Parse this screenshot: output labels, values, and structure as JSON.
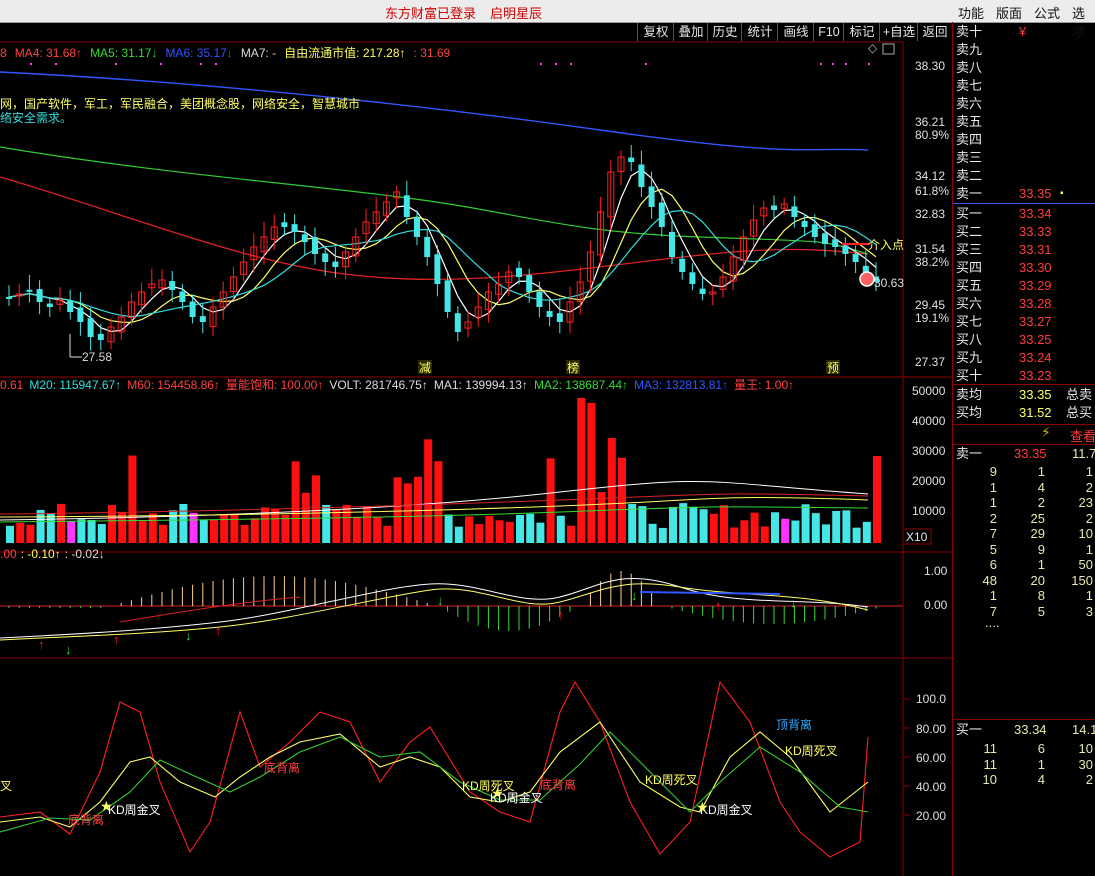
{
  "topbar": {
    "login_status": "东方财富已登录",
    "brand": "启明星辰",
    "menus": [
      "功能",
      "版面",
      "公式",
      "选项"
    ]
  },
  "toolbar": [
    "复权",
    "叠加",
    "历史",
    "统计",
    "画线",
    "F10",
    "标记",
    "+自选",
    "返回"
  ],
  "ma_bar": {
    "items": [
      {
        "text": "8",
        "color": "#ff4040"
      },
      {
        "text": "MA4: 31.68↑",
        "color": "#ff4040"
      },
      {
        "text": "MA5: 31.17↓",
        "color": "#33dd33"
      },
      {
        "text": "MA6: 35.17↓",
        "color": "#3355ff"
      },
      {
        "text": "MA7: -",
        "color": "#dddddd"
      },
      {
        "text": "自由流通市值: 217.28↑",
        "color": "#ffff66"
      },
      {
        "text": ": 31.69",
        "color": "#ff4040"
      }
    ]
  },
  "concepts": {
    "line1": "网，国产软件，军工，军民融合，美团概念股，网络安全，智慧城市",
    "line2": "络安全需求。"
  },
  "price_axis": [
    "38.30",
    "36.21",
    "80.9%",
    "34.12",
    "61.8%",
    "32.83",
    "31.54",
    "38.2%",
    "29.45",
    "19.1%",
    "27.37"
  ],
  "price_annotations": {
    "low": "27.58",
    "last": "30.63",
    "entry": "介入点",
    "m1": "减",
    "m2": "榜",
    "m3": "预"
  },
  "vol_bar": {
    "items": [
      {
        "text": "0.61",
        "color": "#ff4040"
      },
      {
        "text": "M20: 115947.67↑",
        "color": "#33dddd"
      },
      {
        "text": "M60: 154458.86↑",
        "color": "#ff4040"
      },
      {
        "text": "量能饱和: 100.00↑",
        "color": "#ff4040"
      },
      {
        "text": "VOLT: 281746.75↑",
        "color": "#dddddd"
      },
      {
        "text": "MA1: 139994.13↑",
        "color": "#dddddd"
      },
      {
        "text": "MA2: 138687.44↑",
        "color": "#33dd33"
      },
      {
        "text": "MA3: 132813.81↑",
        "color": "#3355ff"
      },
      {
        "text": "量王: 1.00↑",
        "color": "#ff4040"
      }
    ]
  },
  "vol_axis": [
    "50000",
    "40000",
    "30000",
    "20000",
    "10000"
  ],
  "vol_unit": "X10",
  "macd_bar": {
    "items": [
      {
        "text": ".00",
        "color": "#ff4040"
      },
      {
        "text": ": -0.10↑",
        "color": "#ffff66"
      },
      {
        "text": ": -0.02↓",
        "color": "#dddddd"
      }
    ]
  },
  "macd_axis": [
    "1.00",
    "0.00"
  ],
  "kd_axis": [
    "100.0",
    "80.00",
    "60.00",
    "40.00",
    "20.00"
  ],
  "kd_labels": {
    "a": "叉",
    "b": "底背离",
    "c": "KD周金叉",
    "d": "底背离",
    "e": "KD周死叉",
    "f": "KD周金叉",
    "g": "底背离",
    "h": "KD周死叉",
    "i": "KD周金叉",
    "j": "顶背离",
    "k": "KD周死叉"
  },
  "quotes": {
    "asks": [
      {
        "label": "卖十",
        "price": "¥"
      },
      {
        "label": "卖九",
        "price": ""
      },
      {
        "label": "卖八",
        "price": ""
      },
      {
        "label": "卖七",
        "price": ""
      },
      {
        "label": "卖六",
        "price": ""
      },
      {
        "label": "卖五",
        "price": ""
      },
      {
        "label": "卖四",
        "price": ""
      },
      {
        "label": "卖三",
        "price": ""
      },
      {
        "label": "卖二",
        "price": ""
      },
      {
        "label": "卖一",
        "price": "33.35"
      }
    ],
    "bids": [
      {
        "label": "买一",
        "price": "33.34"
      },
      {
        "label": "买二",
        "price": "33.33"
      },
      {
        "label": "买三",
        "price": "33.31"
      },
      {
        "label": "买四",
        "price": "33.30"
      },
      {
        "label": "买五",
        "price": "33.29"
      },
      {
        "label": "买六",
        "price": "33.28"
      },
      {
        "label": "买七",
        "price": "33.27"
      },
      {
        "label": "买八",
        "price": "33.25"
      },
      {
        "label": "买九",
        "price": "33.24"
      },
      {
        "label": "买十",
        "price": "33.23"
      }
    ],
    "avg_sell": {
      "label": "卖均",
      "price": "33.35",
      "tail": "总卖"
    },
    "avg_buy": {
      "label": "买均",
      "price": "31.52",
      "tail": "总买"
    },
    "view_more": "查看",
    "sell1": {
      "label": "卖一",
      "price": "33.35",
      "tail": "11.7"
    },
    "queue": [
      [
        "9",
        "1",
        "1"
      ],
      [
        "1",
        "4",
        "2"
      ],
      [
        "1",
        "2",
        "23"
      ],
      [
        "2",
        "25",
        "2"
      ],
      [
        "7",
        "29",
        "10"
      ],
      [
        "5",
        "9",
        "1"
      ],
      [
        "6",
        "1",
        "50"
      ],
      [
        "48",
        "20",
        "150"
      ],
      [
        "1",
        "8",
        "1"
      ],
      [
        "7",
        "5",
        "3"
      ]
    ],
    "ellipsis": "....",
    "buy1": {
      "label": "买一",
      "price": "33.34",
      "tail": "14.1"
    },
    "buy_queue": [
      [
        "11",
        "6",
        "10"
      ],
      [
        "11",
        "1",
        "30"
      ],
      [
        "10",
        "4",
        "2"
      ]
    ]
  },
  "colors": {
    "up": "#ff2020",
    "down": "#44e6e6",
    "accent": "#ffff66"
  }
}
